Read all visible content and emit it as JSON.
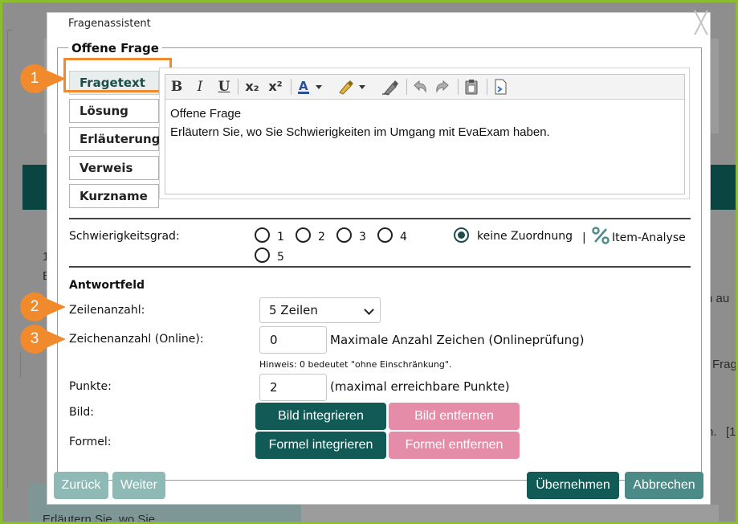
{
  "background": {
    "texts": [
      "1",
      "E",
      "n au",
      "Frag",
      "n.",
      "[1",
      "Erläutern Sie, wo Sie"
    ]
  },
  "dialog": {
    "title": "Fragenassistent",
    "close_glyph": "╳",
    "legend": "Offene Frage",
    "tabs": [
      {
        "label": "Fragetext",
        "active": true
      },
      {
        "label": "Lösung",
        "active": false
      },
      {
        "label": "Erläuterung",
        "active": false
      },
      {
        "label": "Verweis",
        "active": false
      },
      {
        "label": "Kurzname",
        "active": false
      }
    ],
    "toolbar": {
      "bold": "B",
      "italic": "I",
      "underline": "U",
      "subscript": "x₂",
      "superscript": "x²"
    },
    "editor_lines": [
      "Offene Frage",
      "Erläutern Sie, wo Sie Schwierigkeiten im Umgang mit EvaExam haben."
    ],
    "difficulty": {
      "label": "Schwierigkeitsgrad:",
      "options": [
        "1",
        "2",
        "3",
        "4",
        "5"
      ],
      "no_assignment_label": "keine Zuordnung",
      "selected": "keine Zuordnung",
      "separator": "|",
      "item_analysis_label": "Item-Analyse"
    },
    "answer_field": {
      "heading": "Antwortfeld",
      "rows_label": "Zeilenanzahl:",
      "rows_value": "5 Zeilen",
      "chars_label": "Zeichenanzahl (Online):",
      "chars_value": "0",
      "chars_hint": "Maximale Anzahl Zeichen (Onlineprüfung)",
      "chars_note": "Hinweis: 0 bedeutet \"ohne Einschränkung\".",
      "points_label": "Punkte:",
      "points_value": "2",
      "points_hint": "(maximal erreichbare Punkte)",
      "image_label": "Bild:",
      "image_add": "Bild integrieren",
      "image_remove": "Bild entfernen",
      "formula_label": "Formel:",
      "formula_add": "Formel integrieren",
      "formula_remove": "Formel entfernen"
    },
    "footer": {
      "back": "Zurück",
      "next": "Weiter",
      "apply": "Übernehmen",
      "cancel": "Abbrechen"
    }
  },
  "callouts": [
    "1",
    "2",
    "3"
  ],
  "colors": {
    "frame": "#8cbd2c",
    "callout": "#f08a2c",
    "teal": "#115a55",
    "pink": "#e58ca9"
  }
}
